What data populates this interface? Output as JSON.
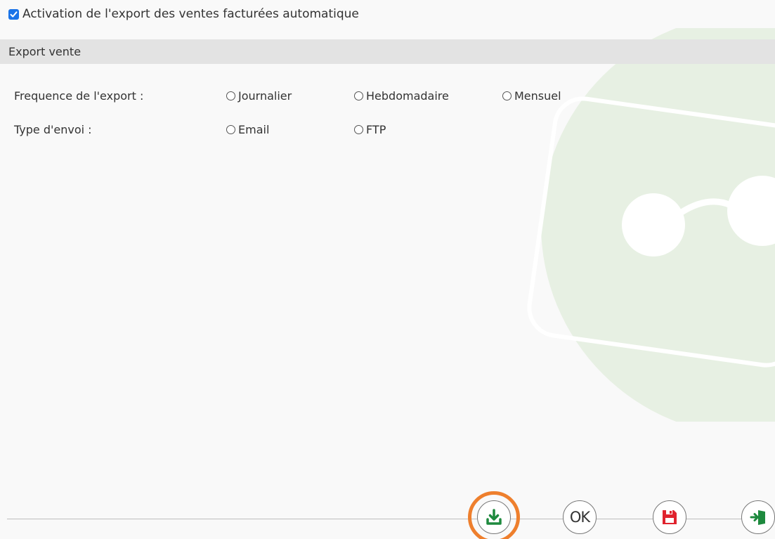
{
  "auto_export": {
    "checked": true,
    "label": "Activation de l'export des ventes facturées automatique"
  },
  "section": {
    "title": "Export vente"
  },
  "frequency": {
    "label": "Frequence de l'export :",
    "options": [
      "Journalier",
      "Hebdomadaire",
      "Mensuel"
    ],
    "selected": null
  },
  "send_type": {
    "label": "Type d'envoi :",
    "options": [
      "Email",
      "FTP"
    ],
    "selected": null
  },
  "toolbar": {
    "buttons": [
      {
        "name": "download",
        "icon": "download-icon",
        "color": "#1e8a3e",
        "highlighted": true
      },
      {
        "name": "ok",
        "label": "OK",
        "icon": null
      },
      {
        "name": "save",
        "icon": "floppy-disk-icon",
        "color": "#e0232e"
      },
      {
        "name": "exit",
        "icon": "exit-door-icon",
        "color": "#1e8a3e"
      }
    ]
  },
  "colors": {
    "checkbox": "#1a73e8",
    "section_bar": "#e3e3e3",
    "highlight_ring": "#ee7f2d",
    "watermark": "#e6efe2"
  }
}
